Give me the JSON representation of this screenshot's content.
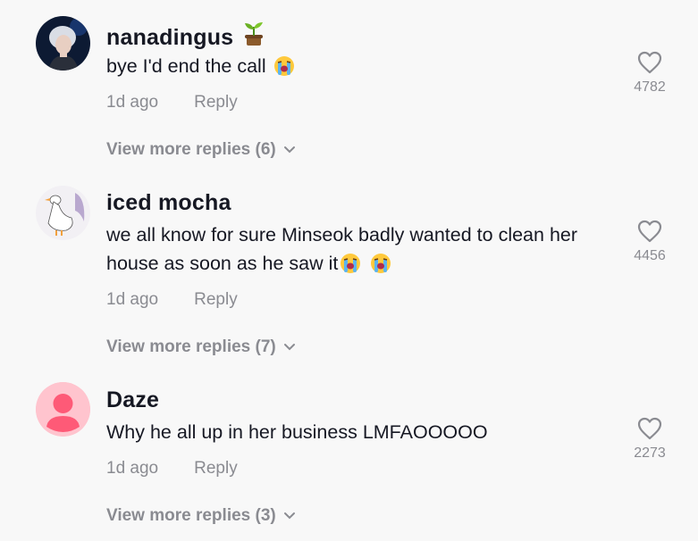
{
  "comments": [
    {
      "username": "nanadingus",
      "badge_icon": "seedling-icon",
      "text": "bye I'd end the call ",
      "time": "1d ago",
      "reply_label": "Reply",
      "likes": "4782",
      "view_more": "View more replies (6)"
    },
    {
      "username": "iced mocha",
      "text": "we all know for sure Minseok badly wanted to clean her house as soon as he saw it",
      "time": "1d ago",
      "reply_label": "Reply",
      "likes": "4456",
      "view_more": "View more replies (7)"
    },
    {
      "username": "Daze",
      "text": "Why he all up in her business LMFAOOOOO",
      "time": "1d ago",
      "reply_label": "Reply",
      "likes": "2273",
      "view_more": "View more replies (3)"
    }
  ],
  "colors": {
    "background": "#f8f8f8",
    "text": "#161823",
    "muted": "#8a8b91",
    "default_avatar": "#fe2c55"
  }
}
